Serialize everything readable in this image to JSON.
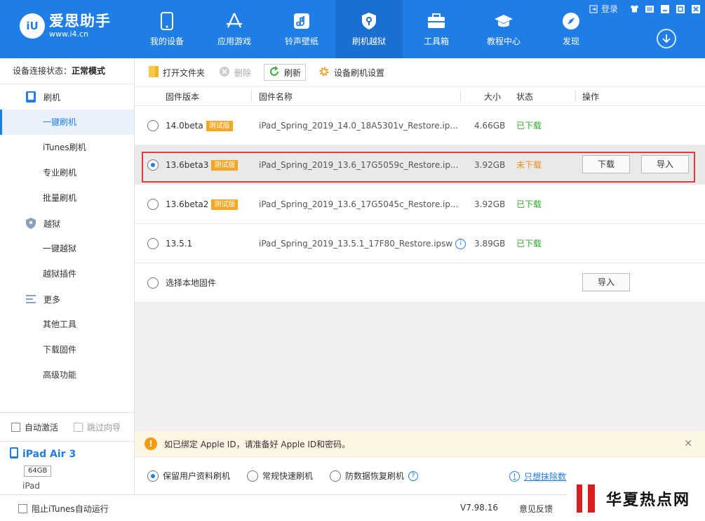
{
  "app": {
    "logo_badge": "iU",
    "logo_name": "爱思助手",
    "logo_url": "www.i4.cn",
    "login": "登录"
  },
  "nav": [
    {
      "label": "我的设备",
      "icon": "phone-icon"
    },
    {
      "label": "应用游戏",
      "icon": "appstore-icon"
    },
    {
      "label": "铃声壁纸",
      "icon": "music-icon"
    },
    {
      "label": "刷机越狱",
      "icon": "shield-icon",
      "active": true
    },
    {
      "label": "工具箱",
      "icon": "toolbox-icon"
    },
    {
      "label": "教程中心",
      "icon": "graduation-icon"
    },
    {
      "label": "发现",
      "icon": "compass-icon"
    }
  ],
  "sidebar": {
    "status_label": "设备连接状态：",
    "status_value": "正常模式",
    "group_flash": "刷机",
    "items_flash": [
      "一键刷机",
      "iTunes刷机",
      "专业刷机",
      "批量刷机"
    ],
    "group_jailbreak": "越狱",
    "items_jailbreak": [
      "一键越狱",
      "越狱插件"
    ],
    "group_more": "更多",
    "items_more": [
      "其他工具",
      "下载固件",
      "高级功能"
    ],
    "auto_activate": "自动激活",
    "skip_guide": "跳过向导",
    "device_name": "iPad Air 3",
    "device_capacity": "64GB",
    "device_type": "iPad"
  },
  "toolbar": {
    "open_folder": "打开文件夹",
    "delete": "删除",
    "refresh": "刷新",
    "settings": "设备刷机设置"
  },
  "table": {
    "headers": {
      "version": "固件版本",
      "name": "固件名称",
      "size": "大小",
      "status": "状态",
      "ops": "操作"
    },
    "rows": [
      {
        "version": "14.0beta",
        "tag": "测试版",
        "name": "iPad_Spring_2019_14.0_18A5301v_Restore.ip...",
        "size": "4.66GB",
        "status": "已下载"
      },
      {
        "version": "13.6beta3",
        "tag": "测试版",
        "name": "iPad_Spring_2019_13.6_17G5059c_Restore.ip...",
        "size": "3.92GB",
        "status": "未下载",
        "btn_download": "下载",
        "btn_import": "导入"
      },
      {
        "version": "13.6beta2",
        "tag": "测试版",
        "name": "iPad_Spring_2019_13.6_17G5045c_Restore.ip...",
        "size": "3.92GB",
        "status": "已下载"
      },
      {
        "version": "13.5.1",
        "tag": "",
        "name": "iPad_Spring_2019_13.5.1_17F80_Restore.ipsw",
        "size": "3.89GB",
        "status": "已下载"
      }
    ],
    "local": {
      "label": "选择本地固件",
      "btn_import": "导入"
    }
  },
  "notice": {
    "text": "如已绑定 Apple ID，请准备好 Apple ID和密码。"
  },
  "modes": {
    "keep_data": "保留用户资料刷机",
    "quick": "常规快速刷机",
    "anti_recovery": "防数据恢复刷机",
    "erase_link": "只想抹除数"
  },
  "footer": {
    "block_itunes": "阻止iTunes自动运行",
    "version": "V7.98.16",
    "feedback": "意见反馈"
  },
  "watermark": {
    "text": "华夏热点网"
  },
  "colors": {
    "brand": "#1f7ee6",
    "downloaded": "#2aa82a",
    "not_downloaded": "#f08a1a",
    "beta_tag": "#f5a623",
    "highlight_border": "#e23b3b"
  }
}
